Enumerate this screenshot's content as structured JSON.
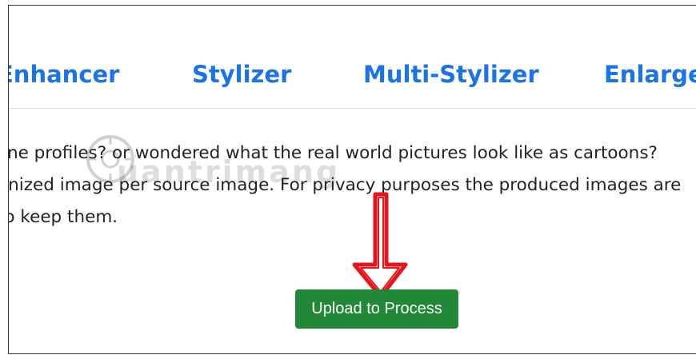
{
  "nav": {
    "items": [
      {
        "label": "Enhancer"
      },
      {
        "label": "Stylizer"
      },
      {
        "label": "Multi-Stylizer"
      },
      {
        "label": "Enlarger"
      }
    ]
  },
  "description": {
    "lines": [
      "line profiles? or wondered what the real world pictures look like as cartoons?",
      "onized image per source image. For privacy purposes the produced images are",
      "to keep them."
    ]
  },
  "watermark": {
    "text": "uantrimang"
  },
  "upload_button": {
    "label": "Upload to Process"
  },
  "colors": {
    "link": "#1a73e8",
    "button": "#218838",
    "arrow": "#e8141c"
  }
}
